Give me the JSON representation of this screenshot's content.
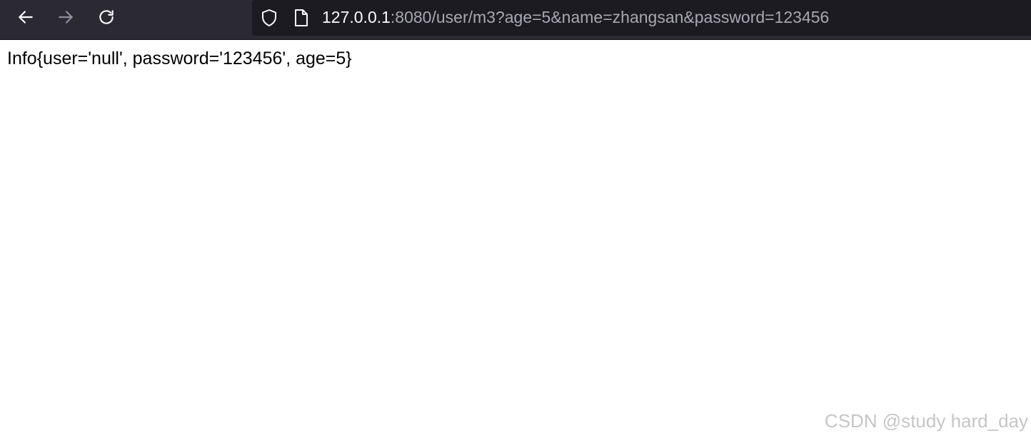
{
  "toolbar": {
    "back_icon": "arrow-left-icon",
    "forward_icon": "arrow-right-icon",
    "reload_icon": "reload-icon",
    "url": {
      "host": "127.0.0.1",
      "rest": ":8080/user/m3?age=5&name=zhangsan&password=123456",
      "security_icon": "shield-icon",
      "page_icon": "page-icon"
    }
  },
  "page": {
    "body_text": "Info{user='null', password='123456', age=5}"
  },
  "watermark": {
    "text": "CSDN @study hard_day"
  },
  "colors": {
    "toolbar_bg": "#2b2a33",
    "urlbar_bg": "#1c1b22",
    "url_host": "#fbfbfe",
    "url_rest": "#a8a8b0",
    "icon_active": "#fbfbfe",
    "icon_disabled": "#8f8f9d"
  }
}
